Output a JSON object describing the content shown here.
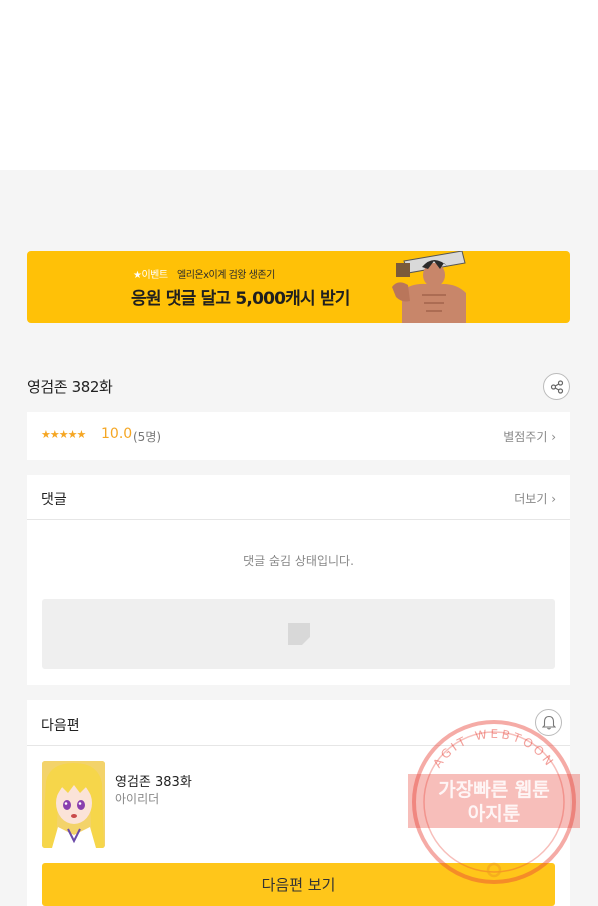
{
  "banner": {
    "tag": "★이벤트",
    "subtitle": "엘리온x이계 검왕 생존기",
    "headline": "응원 댓글 달고 5,000캐시 받기"
  },
  "episode": {
    "title": "영검존 382화"
  },
  "rating": {
    "stars": "★★★★★",
    "score": "10.0",
    "count": "(5명)",
    "rate_label": "별점주기 ›"
  },
  "comments": {
    "label": "댓글",
    "more_label": "더보기 ›",
    "hidden_message": "댓글 숨김 상태입니다."
  },
  "next_episode": {
    "label": "다음편",
    "title": "영검존 383화",
    "author": "아이리더",
    "button_label": "다음편 보기"
  },
  "watermark": {
    "arc_text": "AGIT WEBTOON",
    "line1": "가장빠른 웹툰",
    "line2": "아지툰"
  },
  "colors": {
    "accent": "#ffc107",
    "button": "#ffc61a",
    "star": "#f5a623",
    "stamp": "#e8443a"
  },
  "icons": {
    "share": "share-icon",
    "bell": "bell-icon",
    "image_placeholder": "image-placeholder-icon"
  }
}
